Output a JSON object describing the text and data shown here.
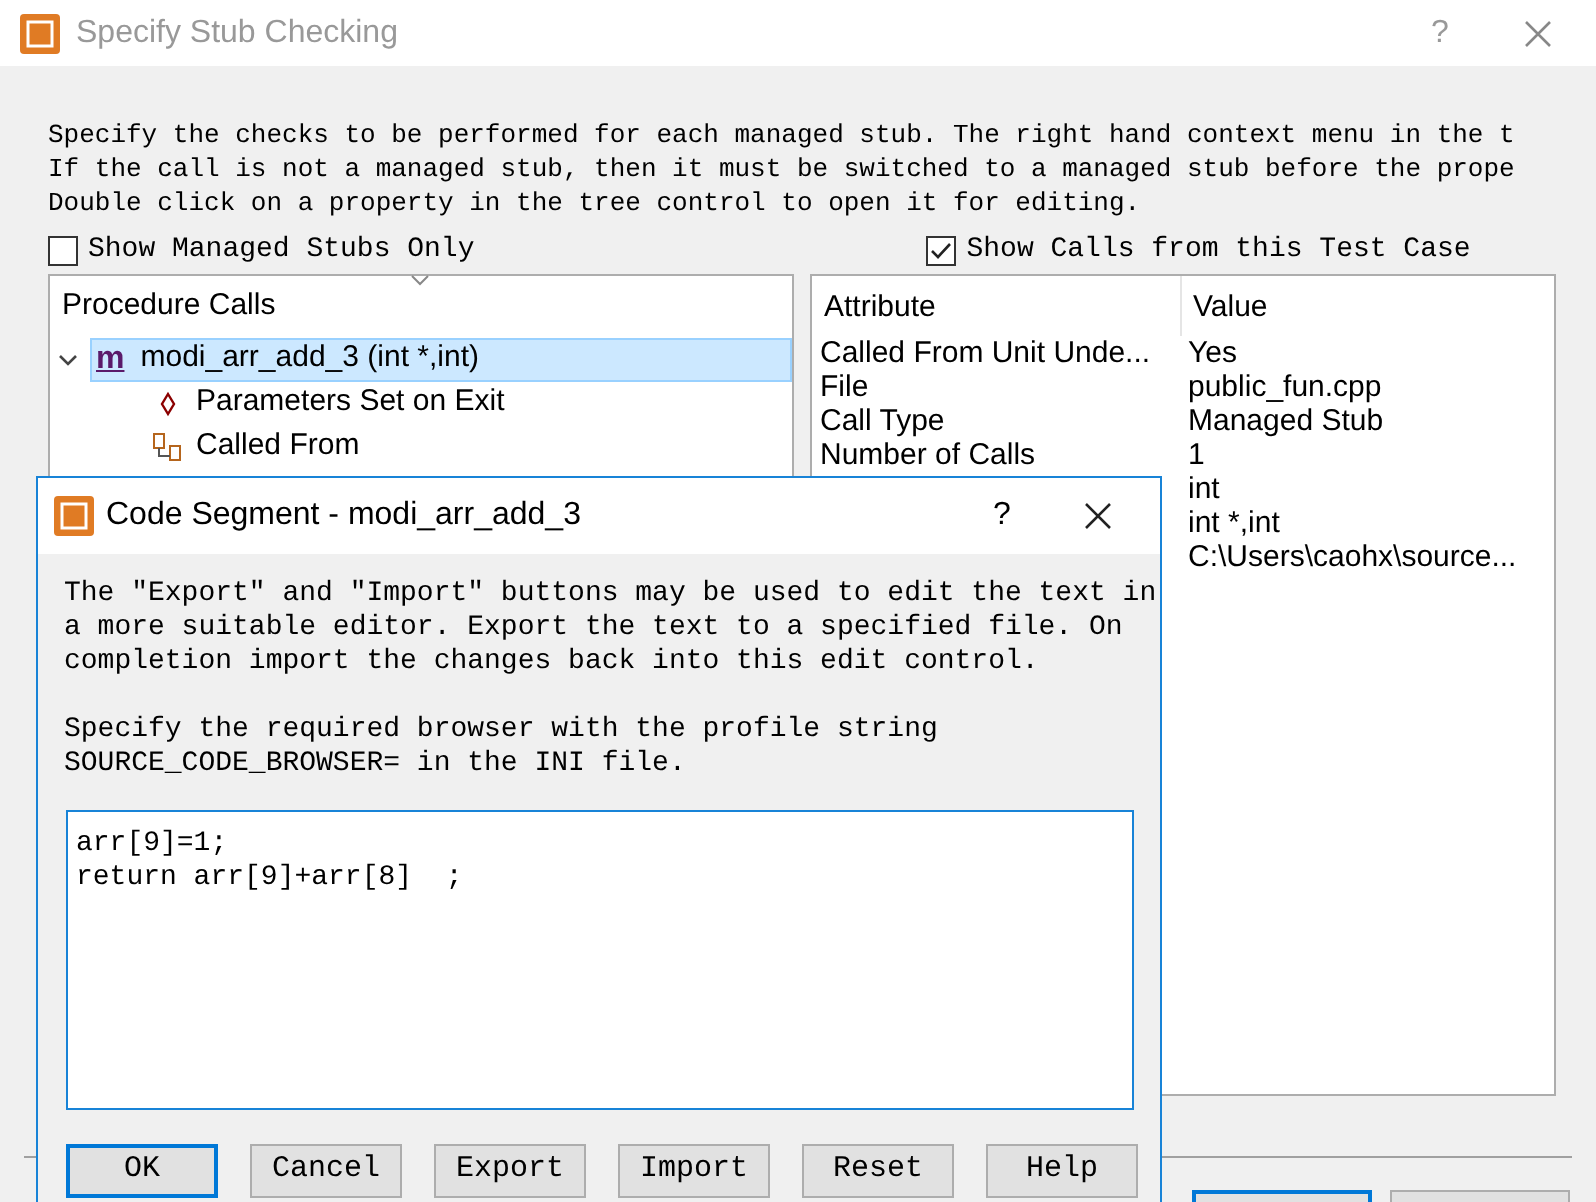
{
  "window": {
    "title": "Specify Stub Checking",
    "help": "?"
  },
  "instructions": [
    "Specify the checks to be performed for each managed stub. The right hand context menu in the t",
    "If the call is not a managed stub, then it must be switched to a managed stub before the prope",
    "Double click on a property in the tree control to open it for editing."
  ],
  "options": [
    {
      "label": "Show Managed Stubs Only",
      "checked": false
    },
    {
      "label": "Show Calls from this Test Case",
      "checked": true
    }
  ],
  "tree": {
    "header": "Procedure Calls",
    "items": [
      {
        "kind": "procedure",
        "icon_char": "m",
        "label": "modi_arr_add_3 (int *,int)",
        "selected": true,
        "expanded": true,
        "children": [
          {
            "kind": "parameters",
            "label": "Parameters Set on Exit",
            "selected": false
          },
          {
            "kind": "calledfrom",
            "label": "Called From",
            "selected": false
          }
        ]
      }
    ]
  },
  "attributes": {
    "columns": [
      "Attribute",
      "Value"
    ],
    "rows": [
      {
        "attribute": "Called From Unit Unde...",
        "value": "Yes"
      },
      {
        "attribute": "File",
        "value": "public_fun.cpp"
      },
      {
        "attribute": "Call Type",
        "value": "Managed Stub"
      },
      {
        "attribute": "Number of Calls",
        "value": "1"
      },
      {
        "value": "int"
      },
      {
        "value": "int *,int"
      },
      {
        "value": "C:\\Users\\caohx\\source..."
      }
    ]
  },
  "dialog": {
    "title": "Code Segment - modi_arr_add_3",
    "help": "?",
    "paragraphs": [
      [
        "The ″Export″ and ″Import″ buttons may be used to edit the text in",
        "a more suitable editor. Export the text to a specified file. On",
        "completion import the changes back into this edit control."
      ],
      [
        "Specify the required browser with the profile string",
        "SOURCE_CODE_BROWSER= in the INI file."
      ]
    ],
    "code": "arr[9]=1;\nreturn arr[9]+arr[8]  ;",
    "buttons": [
      {
        "label": "OK",
        "default": true
      },
      {
        "label": "Cancel",
        "default": false
      },
      {
        "label": "Export",
        "default": false
      },
      {
        "label": "Import",
        "default": false
      },
      {
        "label": "Reset",
        "default": false
      },
      {
        "label": "Help",
        "default": false
      }
    ]
  },
  "main_buttons": [
    {
      "default": true
    },
    {
      "default": false
    }
  ]
}
